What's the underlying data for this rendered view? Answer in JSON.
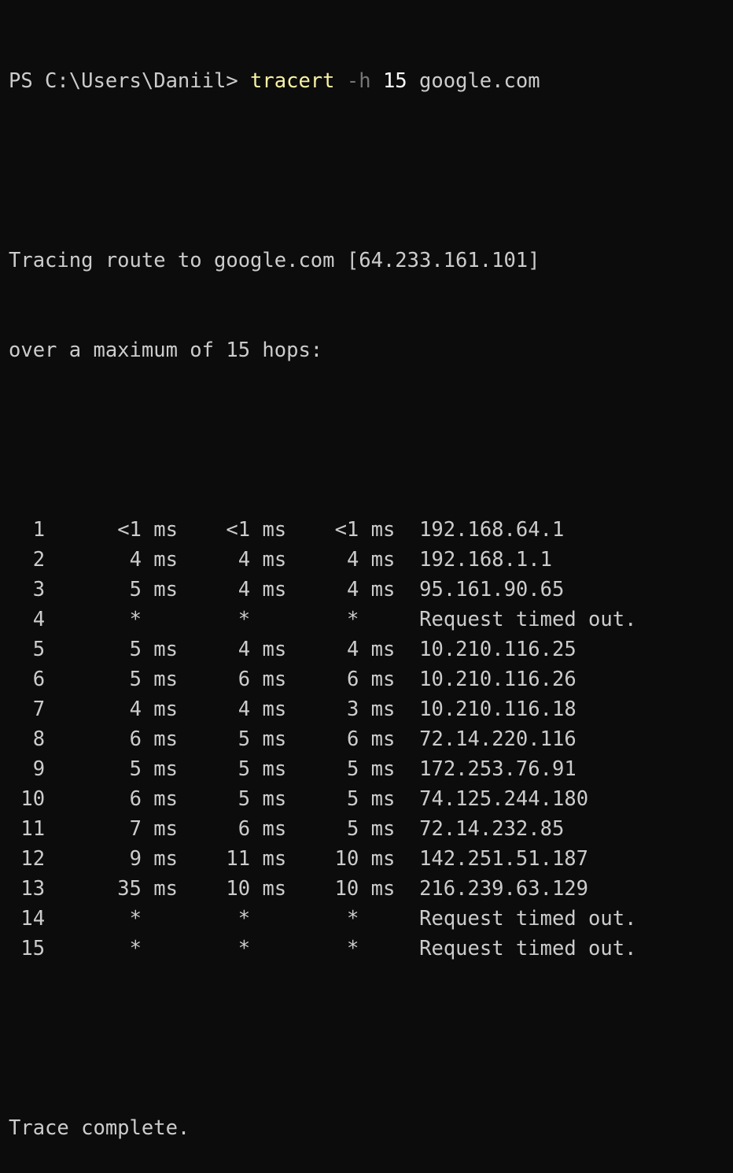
{
  "prompt": {
    "text": "PS C:\\Users\\Daniil> ",
    "command": "tracert",
    "flag": "-h",
    "hop_count": "15",
    "target": "google.com"
  },
  "header": {
    "line1": "Tracing route to google.com [64.233.161.101]",
    "line2": "over a maximum of 15 hops:"
  },
  "hops": [
    {
      "hop": "1",
      "t1": "<1 ms",
      "t2": "<1 ms",
      "t3": "<1 ms",
      "host": "192.168.64.1"
    },
    {
      "hop": "2",
      "t1": "4 ms",
      "t2": "4 ms",
      "t3": "4 ms",
      "host": "192.168.1.1"
    },
    {
      "hop": "3",
      "t1": "5 ms",
      "t2": "4 ms",
      "t3": "4 ms",
      "host": "95.161.90.65"
    },
    {
      "hop": "4",
      "t1": "*",
      "t2": "*",
      "t3": "*",
      "host": "Request timed out."
    },
    {
      "hop": "5",
      "t1": "5 ms",
      "t2": "4 ms",
      "t3": "4 ms",
      "host": "10.210.116.25"
    },
    {
      "hop": "6",
      "t1": "5 ms",
      "t2": "6 ms",
      "t3": "6 ms",
      "host": "10.210.116.26"
    },
    {
      "hop": "7",
      "t1": "4 ms",
      "t2": "4 ms",
      "t3": "3 ms",
      "host": "10.210.116.18"
    },
    {
      "hop": "8",
      "t1": "6 ms",
      "t2": "5 ms",
      "t3": "6 ms",
      "host": "72.14.220.116"
    },
    {
      "hop": "9",
      "t1": "5 ms",
      "t2": "5 ms",
      "t3": "5 ms",
      "host": "172.253.76.91"
    },
    {
      "hop": "10",
      "t1": "6 ms",
      "t2": "5 ms",
      "t3": "5 ms",
      "host": "74.125.244.180"
    },
    {
      "hop": "11",
      "t1": "7 ms",
      "t2": "6 ms",
      "t3": "5 ms",
      "host": "72.14.232.85"
    },
    {
      "hop": "12",
      "t1": "9 ms",
      "t2": "11 ms",
      "t3": "10 ms",
      "host": "142.251.51.187"
    },
    {
      "hop": "13",
      "t1": "35 ms",
      "t2": "10 ms",
      "t3": "10 ms",
      "host": "216.239.63.129"
    },
    {
      "hop": "14",
      "t1": "*",
      "t2": "*",
      "t3": "*",
      "host": "Request timed out."
    },
    {
      "hop": "15",
      "t1": "*",
      "t2": "*",
      "t3": "*",
      "host": "Request timed out."
    }
  ],
  "footer": "Trace complete.",
  "colors": {
    "background": "#0c0c0c",
    "text": "#cccccc",
    "command": "#f9f1a5",
    "flag": "#767676",
    "number": "#ffffff"
  }
}
